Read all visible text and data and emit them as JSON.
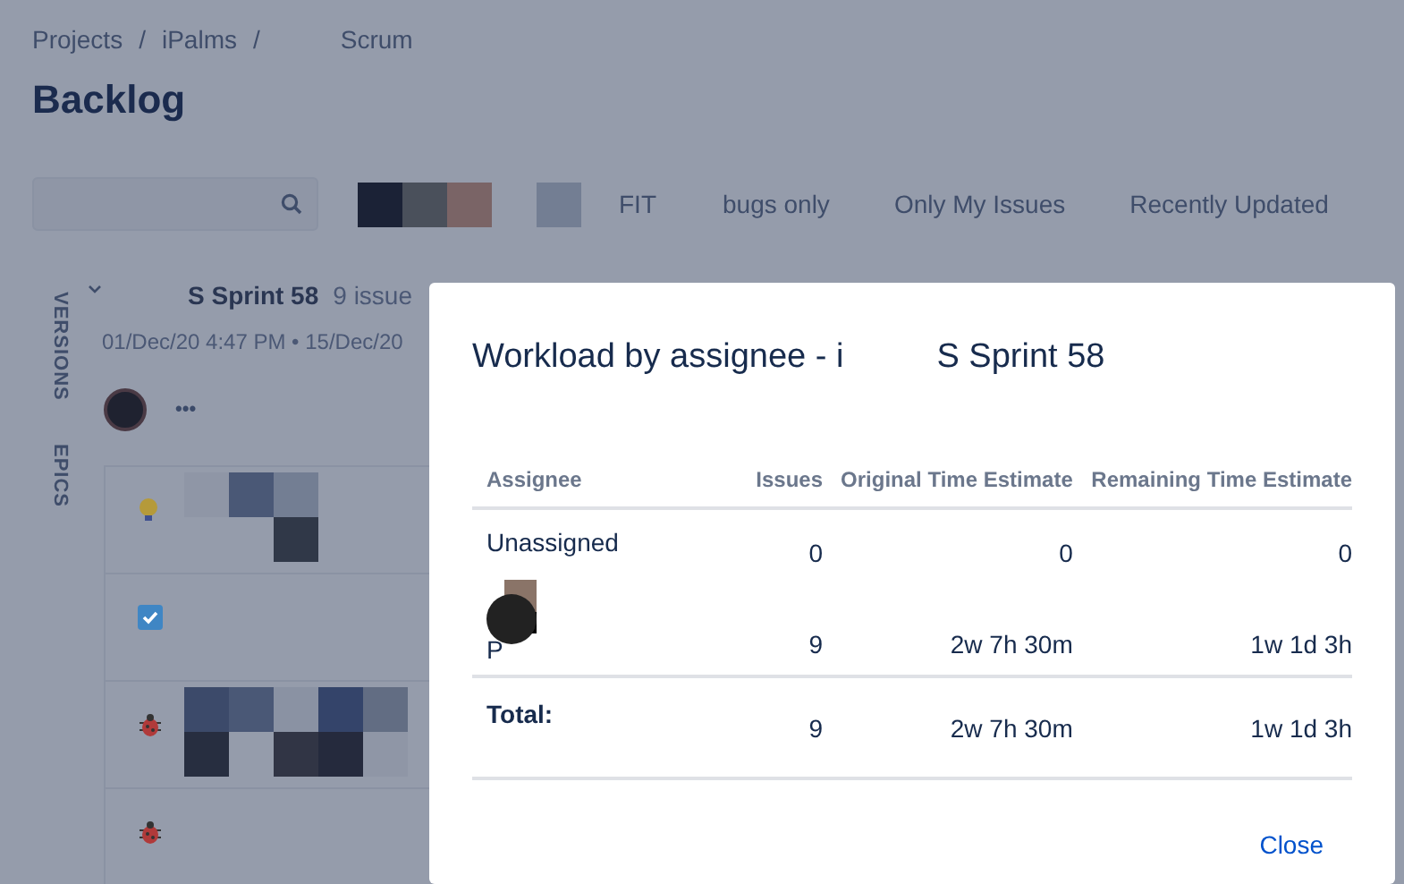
{
  "breadcrumbs": [
    {
      "text": "Projects",
      "separator": "/"
    },
    {
      "text": "iPalms",
      "separator": "/"
    },
    {
      "text": "Scrum"
    }
  ],
  "page_title": "Backlog",
  "quick_filters": [
    "FIT",
    "bugs only",
    "Only My Issues",
    "Recently Updated"
  ],
  "side_tabs": [
    "VERSIONS",
    "EPICS"
  ],
  "sprint": {
    "name": "S Sprint 58",
    "issue_count": "9 issue",
    "dates": "01/Dec/20 4:47 PM • 15/Dec/20",
    "expanded": true,
    "more": "•••"
  },
  "issues": [
    {
      "kind": "idea"
    },
    {
      "kind": "task"
    },
    {
      "kind": "bug"
    },
    {
      "kind": "bug"
    }
  ],
  "dialog": {
    "title_start": "Workload by assignee - i",
    "title_end": "S Sprint 58",
    "columns": [
      "Assignee",
      "Issues",
      "Original Time Estimate",
      "Remaining Time Estimate"
    ],
    "rows": [
      {
        "assignee": "Unassigned",
        "avatar": false,
        "issues": "0",
        "original": "0",
        "remaining": "0"
      },
      {
        "assignee": "P",
        "avatar": true,
        "issues": "9",
        "original": "2w 7h 30m",
        "remaining": "1w 1d 3h"
      }
    ],
    "total": {
      "label": "Total:",
      "issues": "9",
      "original": "2w 7h 30m",
      "remaining": "1w 1d 3h"
    },
    "close": "Close"
  }
}
